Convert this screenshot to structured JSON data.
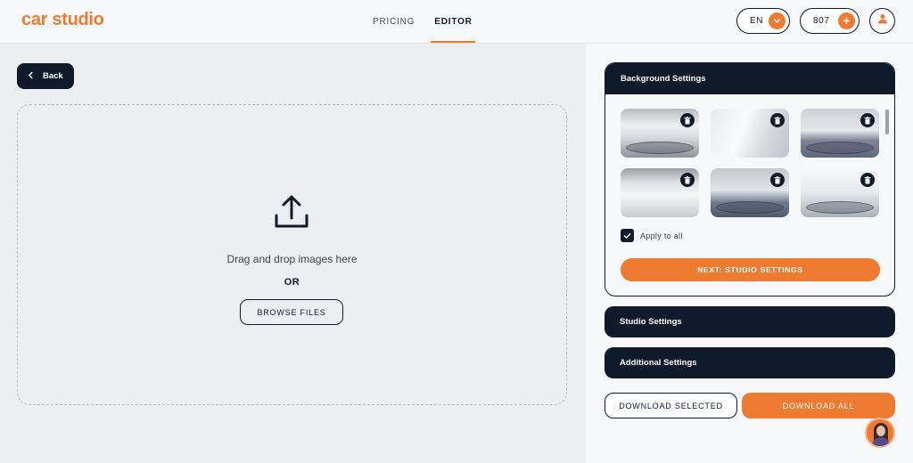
{
  "header": {
    "logo": "car studio",
    "nav": [
      {
        "label": "PRICING"
      },
      {
        "label": "EDITOR",
        "active": true
      }
    ],
    "language": "EN",
    "credits": "807"
  },
  "editor": {
    "back_label": "Back",
    "drop_text": "Drag and drop images here",
    "or_text": "OR",
    "browse_label": "BROWSE FILES"
  },
  "sidebar": {
    "background_settings": {
      "title": "Background Settings",
      "thumbnails": [
        {
          "name": "background-1"
        },
        {
          "name": "background-2"
        },
        {
          "name": "background-3"
        },
        {
          "name": "background-4"
        },
        {
          "name": "background-5"
        },
        {
          "name": "background-6"
        }
      ],
      "apply_to_all_label": "Apply to all",
      "apply_to_all_checked": true,
      "next_label": "NEXT: STUDIO SETTINGS"
    },
    "studio_settings_title": "Studio Settings",
    "additional_settings_title": "Additional Settings",
    "download_selected_label": "DOWNLOAD SELECTED",
    "download_all_label": "DOWNLOAD ALL"
  },
  "colors": {
    "accent": "#ef7a31",
    "navy": "#0f1b2b",
    "background": "#eceef2"
  },
  "icons": [
    "chevron-down-icon",
    "plus-icon",
    "user-icon",
    "chevron-left-icon",
    "upload-icon",
    "trash-icon",
    "check-icon",
    "chat-avatar"
  ]
}
